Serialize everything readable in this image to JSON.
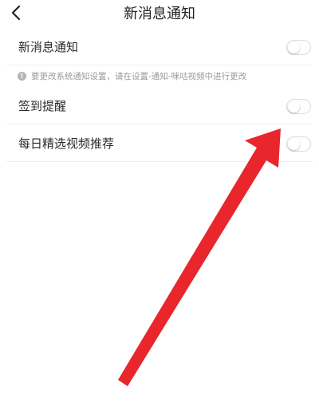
{
  "header": {
    "title": "新消息通知"
  },
  "settings": {
    "new_message": {
      "label": "新消息通知",
      "enabled": false
    },
    "hint": "要更改系统通知设置，请在设置-通知-咪咕视频中进行更改",
    "checkin_reminder": {
      "label": "签到提醒",
      "enabled": false
    },
    "daily_picks": {
      "label": "每日精选视频推荐",
      "enabled": false
    }
  },
  "colors": {
    "arrow": "#e8262b",
    "toggle_border": "#dcdcdc",
    "hint_text": "#9a9a9a"
  }
}
